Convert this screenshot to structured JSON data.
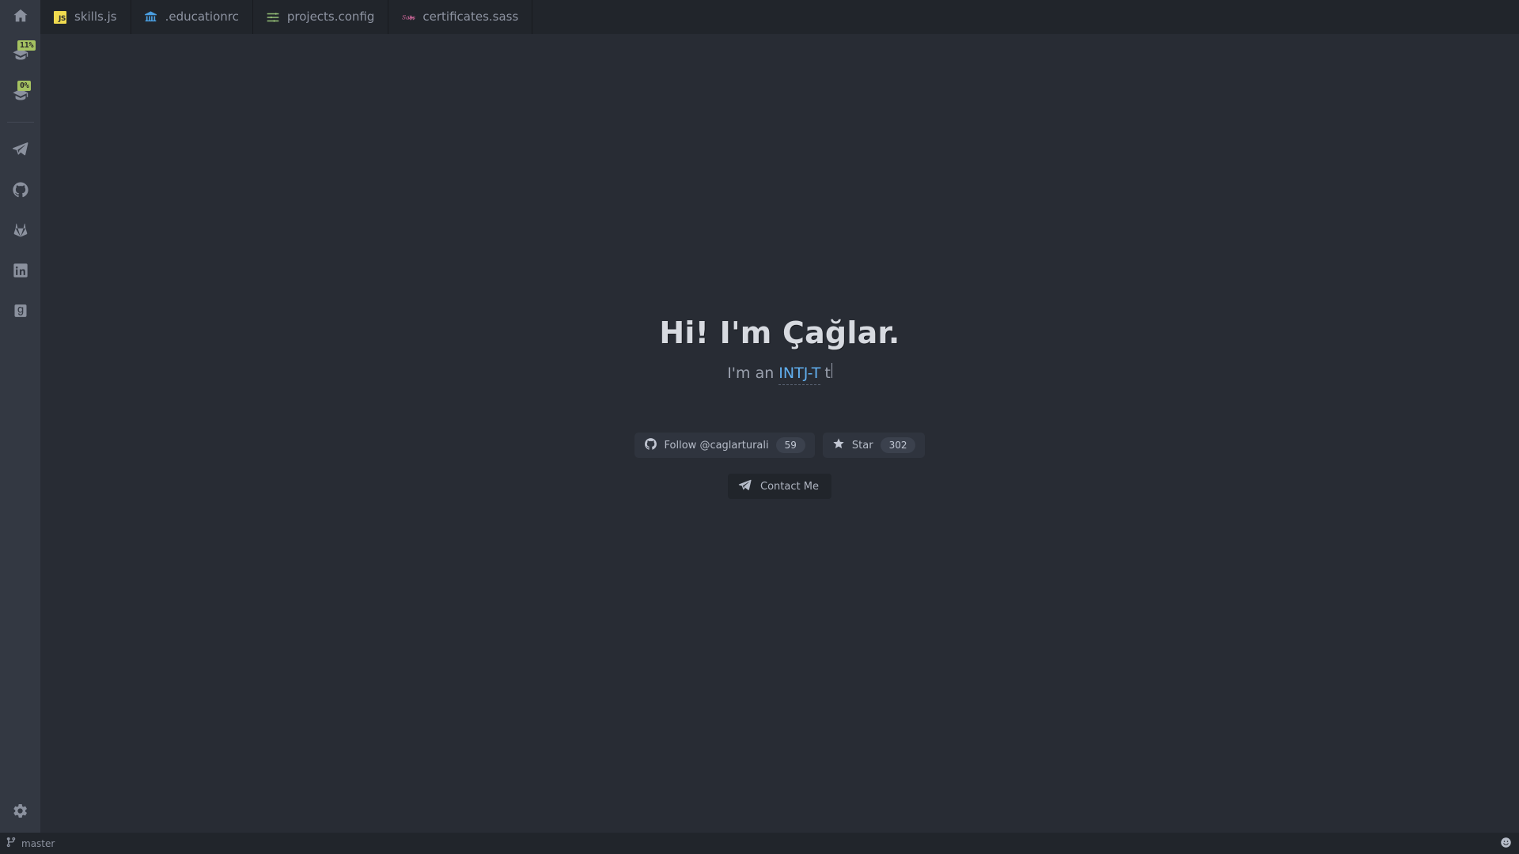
{
  "theme": {
    "editor_bg": "#282c34",
    "chrome_bg": "#21252b",
    "activity_bg": "#333842",
    "accent_blue": "#61afef",
    "badge_green": "#a5c261",
    "text_primary": "#d7dae0",
    "text_muted": "#8b919e",
    "js_yellow": "#f0db4f",
    "sass_pink": "#cd6799"
  },
  "activity_bar": {
    "home": {
      "icon": "home-icon",
      "name": "Home"
    },
    "items": [
      {
        "icon": "graduation-cap-icon",
        "name": "Education",
        "badge": "11%"
      },
      {
        "icon": "graduation-cap-icon",
        "name": "Certificates",
        "badge": "0%"
      },
      {
        "icon": "telegram-icon",
        "name": "Telegram",
        "badge": ""
      },
      {
        "icon": "github-icon",
        "name": "GitHub",
        "badge": ""
      },
      {
        "icon": "gitlab-icon",
        "name": "GitLab",
        "badge": ""
      },
      {
        "icon": "linkedin-icon",
        "name": "LinkedIn",
        "badge": ""
      },
      {
        "icon": "goodreads-icon",
        "name": "Goodreads",
        "badge": ""
      }
    ],
    "settings": {
      "icon": "gear-icon",
      "name": "Settings"
    }
  },
  "tabs": [
    {
      "label": "skills.js",
      "icon": "js-file-icon",
      "active": false
    },
    {
      "label": ".educationrc",
      "icon": "bank-file-icon",
      "active": false
    },
    {
      "label": "projects.config",
      "icon": "sliders-file-icon",
      "active": false
    },
    {
      "label": "certificates.sass",
      "icon": "sass-file-icon",
      "active": false
    }
  ],
  "hero": {
    "title": "Hi! I'm Çağlar.",
    "subtitle_prefix": "I'm an",
    "typed_word": "INTJ-T",
    "typed_tail": "t"
  },
  "github_buttons": {
    "follow": {
      "icon": "github-icon",
      "label": "Follow @caglarturali",
      "count": "59"
    },
    "star": {
      "icon": "star-icon",
      "label": "Star",
      "count": "302"
    }
  },
  "contact": {
    "icon": "telegram-icon",
    "label": "Contact Me"
  },
  "status_bar": {
    "branch_icon": "git-branch-icon",
    "branch": "master",
    "right_icon": "smiley-icon"
  }
}
